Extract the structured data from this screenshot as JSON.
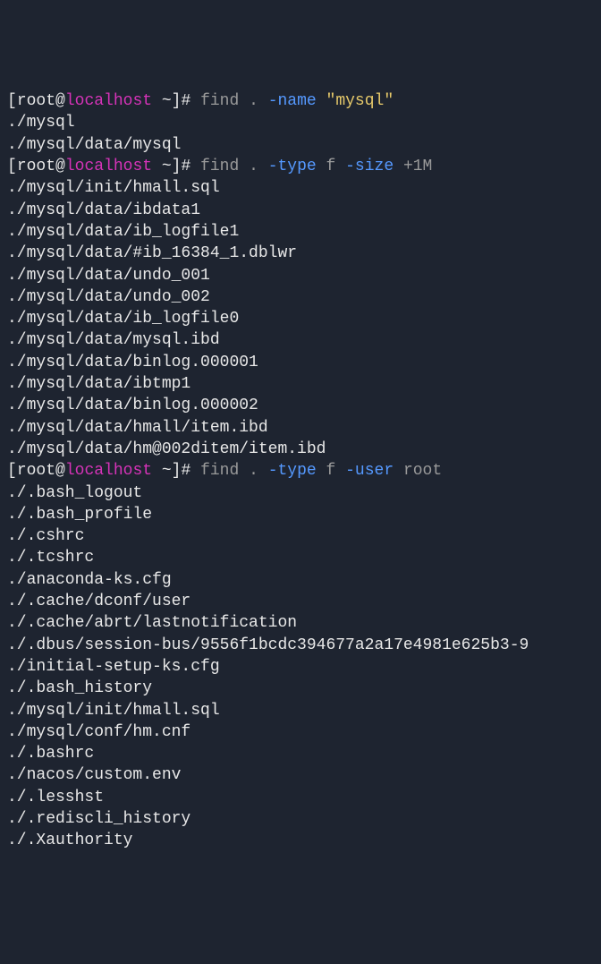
{
  "prompts": [
    {
      "bracket_open": "[",
      "user": "root",
      "at": "@",
      "host": "localhost",
      "path": " ~",
      "bracket_close": "]# ",
      "cmd": "find",
      "arg1": " . ",
      "flag1": "-name",
      "str1": " \"mysql\""
    },
    {
      "bracket_open": "[",
      "user": "root",
      "at": "@",
      "host": "localhost",
      "path": " ~",
      "bracket_close": "]# ",
      "cmd": "find",
      "arg1": " . ",
      "flag1": "-type",
      "arg2": " f ",
      "flag2": "-size",
      "arg3": " +1M"
    },
    {
      "bracket_open": "[",
      "user": "root",
      "at": "@",
      "host": "localhost",
      "path": " ~",
      "bracket_close": "]# ",
      "cmd": "find",
      "arg1": " . ",
      "flag1": "-type",
      "arg2": " f ",
      "flag2": "-user",
      "arg3": " root"
    }
  ],
  "output1": [
    "./mysql",
    "./mysql/data/mysql"
  ],
  "output2": [
    "./mysql/init/hmall.sql",
    "./mysql/data/ibdata1",
    "./mysql/data/ib_logfile1",
    "./mysql/data/#ib_16384_1.dblwr",
    "./mysql/data/undo_001",
    "./mysql/data/undo_002",
    "./mysql/data/ib_logfile0",
    "./mysql/data/mysql.ibd",
    "./mysql/data/binlog.000001",
    "./mysql/data/ibtmp1",
    "./mysql/data/binlog.000002",
    "./mysql/data/hmall/item.ibd",
    "./mysql/data/hm@002ditem/item.ibd"
  ],
  "output3": [
    "./.bash_logout",
    "./.bash_profile",
    "./.cshrc",
    "./.tcshrc",
    "./anaconda-ks.cfg",
    "./.cache/dconf/user",
    "./.cache/abrt/lastnotification",
    "./.dbus/session-bus/9556f1bcdc394677a2a17e4981e625b3-9",
    "./initial-setup-ks.cfg",
    "./.bash_history",
    "./mysql/init/hmall.sql",
    "./mysql/conf/hm.cnf",
    "./.bashrc",
    "./nacos/custom.env",
    "./.lesshst",
    "./.rediscli_history",
    "./.Xauthority"
  ]
}
